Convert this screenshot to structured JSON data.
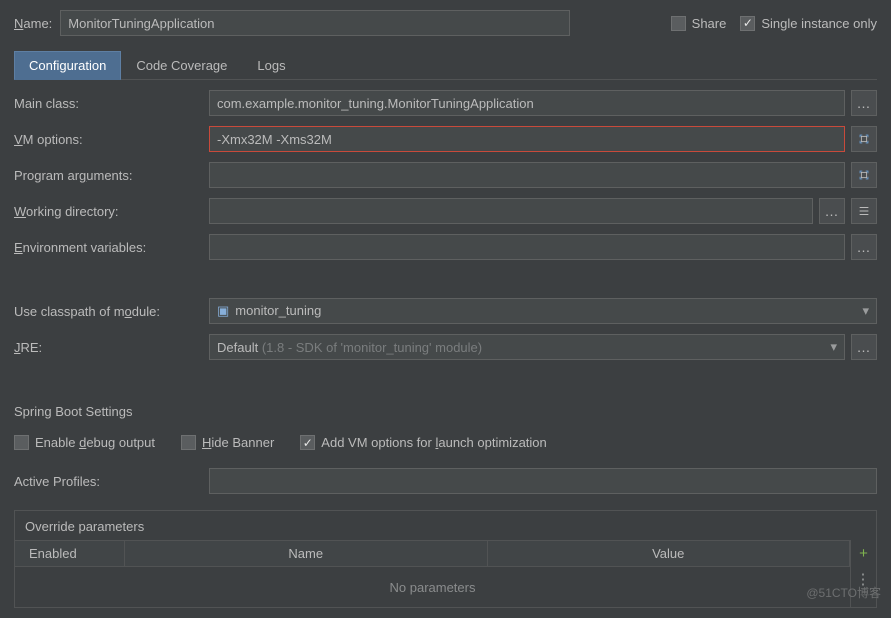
{
  "top": {
    "name_label_pre": "N",
    "name_label_rest": "ame:",
    "name_value": "MonitorTuningApplication",
    "share_label": "Share",
    "share_checked": false,
    "single_instance_label": "Single instance only",
    "single_instance_checked": true
  },
  "tabs": [
    {
      "label": "Configuration",
      "active": true
    },
    {
      "label": "Code Coverage",
      "active": false
    },
    {
      "label": "Logs",
      "active": false
    }
  ],
  "fields": {
    "main_class": {
      "label": "Main class:",
      "value": "com.example.monitor_tuning.MonitorTuningApplication"
    },
    "vm_options": {
      "label_pre": "V",
      "label_rest": "M options:",
      "value": "-Xmx32M -Xms32M"
    },
    "program_args": {
      "label_pre": "",
      "label": "Program ar",
      "label_u": "g",
      "label_post": "uments:",
      "value": ""
    },
    "working_dir": {
      "label_u": "W",
      "label_rest": "orking directory:",
      "value": ""
    },
    "env_vars": {
      "label_u": "E",
      "label_rest": "nvironment variables:",
      "value": ""
    },
    "classpath": {
      "label_pre": "Use classpath of m",
      "label_u": "o",
      "label_post": "dule:",
      "value": "monitor_tuning"
    },
    "jre": {
      "label_u": "J",
      "label_rest": "RE:",
      "value_main": "Default ",
      "value_muted": "(1.8 - SDK of 'monitor_tuning' module)"
    }
  },
  "spring": {
    "title": "Spring Boot Settings",
    "debug_pre": "Enable ",
    "debug_u": "d",
    "debug_post": "ebug output",
    "debug_checked": false,
    "hide_u": "H",
    "hide_post": "ide Banner",
    "hide_checked": false,
    "addvm_pre": "Add VM options for ",
    "addvm_u": "l",
    "addvm_post": "aunch optimization",
    "addvm_checked": true,
    "active_profiles": {
      "label": "Active Profiles:",
      "value": ""
    }
  },
  "override": {
    "title": "Override parameters",
    "cols": {
      "enabled": "Enabled",
      "name": "Name",
      "value": "Value"
    },
    "empty": "No parameters"
  },
  "watermark": "@51CTO博客"
}
